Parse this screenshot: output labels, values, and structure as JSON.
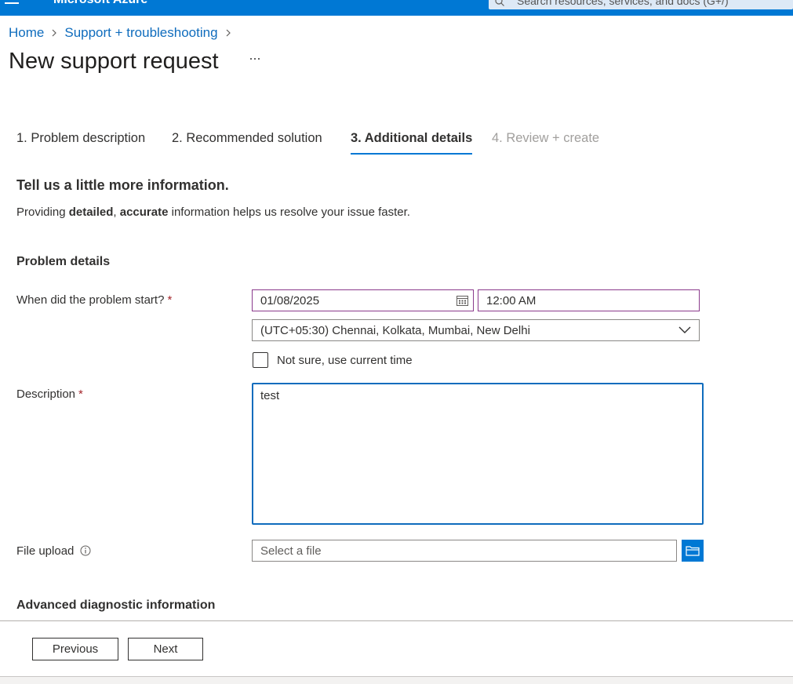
{
  "topbar": {
    "brand": "Microsoft Azure",
    "search_placeholder": "Search resources, services, and docs (G+/)"
  },
  "breadcrumb": {
    "home": "Home",
    "support": "Support + troubleshooting"
  },
  "page": {
    "title": "New support request",
    "more": "..."
  },
  "tabs": [
    {
      "label": "1. Problem description"
    },
    {
      "label": "2. Recommended solution"
    },
    {
      "label": "3. Additional details"
    },
    {
      "label": "4. Review + create"
    }
  ],
  "section": {
    "heading": "Tell us a little more information.",
    "intro_pre": "Providing ",
    "intro_b1": "detailed",
    "intro_mid": ", ",
    "intro_b2": "accurate",
    "intro_post": " information helps us resolve your issue faster."
  },
  "problem_details": {
    "heading": "Problem details",
    "start_label": "When did the problem start?",
    "required_mark": "*",
    "date_value": "01/08/2025",
    "time_value": "12:00 AM",
    "timezone_value": "(UTC+05:30) Chennai, Kolkata, Mumbai, New Delhi",
    "not_sure_label": "Not sure, use current time",
    "description_label": "Description",
    "description_value": "test",
    "file_upload_label": "File upload",
    "file_placeholder": "Select a file"
  },
  "advanced": {
    "heading": "Advanced diagnostic information"
  },
  "footer": {
    "previous": "Previous",
    "next": "Next"
  },
  "colors": {
    "accent": "#0078d4",
    "required": "#a4262c",
    "date_border": "#8a3a8c"
  }
}
